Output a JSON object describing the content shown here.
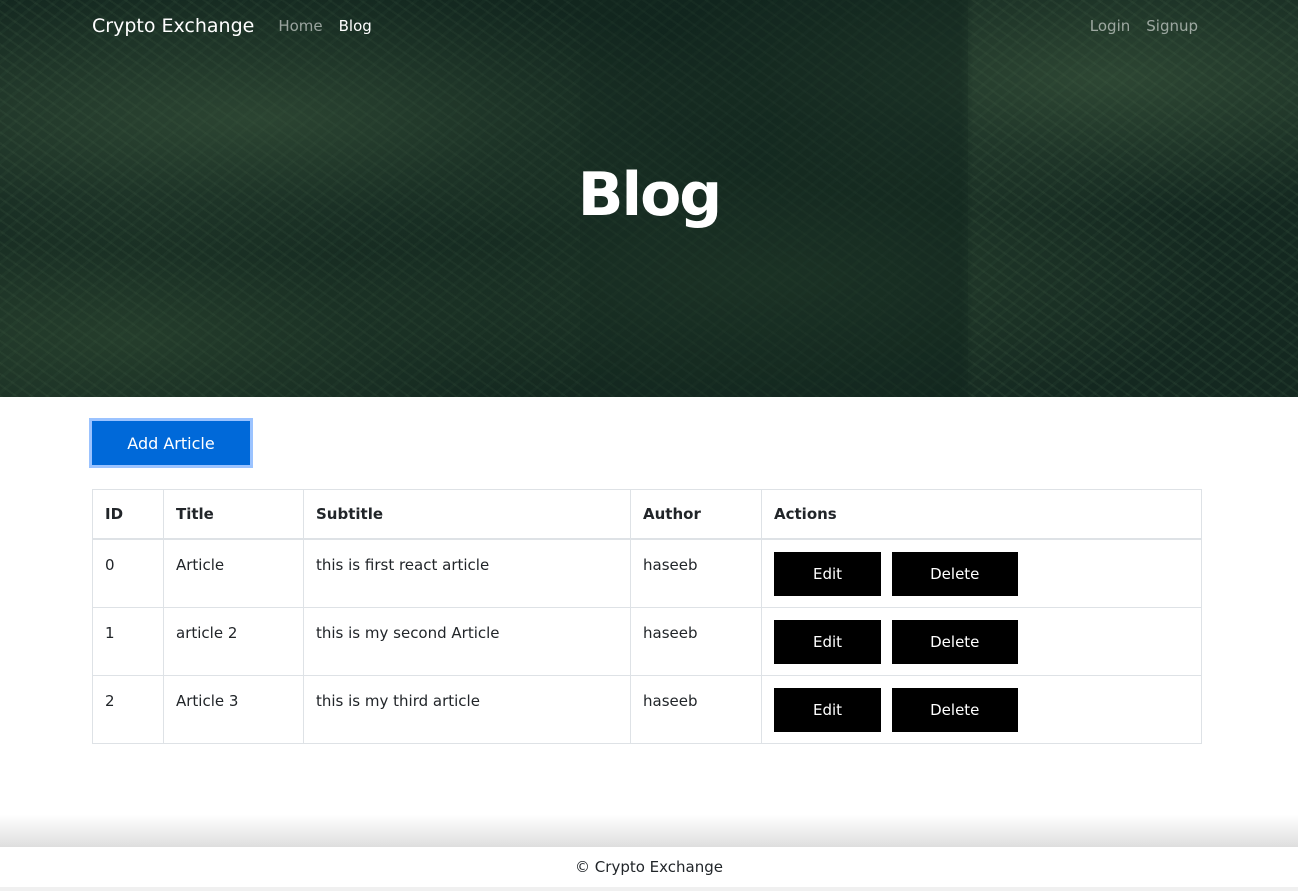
{
  "navbar": {
    "brand": "Crypto Exchange",
    "links": [
      "Home",
      "Blog"
    ],
    "right_links": [
      "Login",
      "Signup"
    ]
  },
  "hero": {
    "title": "Blog"
  },
  "main": {
    "add_button": "Add Article",
    "table": {
      "headers": [
        "ID",
        "Title",
        "Subtitle",
        "Author",
        "Actions"
      ],
      "rows": [
        {
          "id": "0",
          "title": "Article",
          "subtitle": "this is first react article",
          "author": "haseeb"
        },
        {
          "id": "1",
          "title": "article 2",
          "subtitle": "this is my second Article",
          "author": "haseeb"
        },
        {
          "id": "2",
          "title": "Article 3",
          "subtitle": "this is my third article",
          "author": "haseeb"
        }
      ],
      "edit_label": "Edit",
      "delete_label": "Delete"
    }
  },
  "footer": {
    "text": "© Crypto Exchange"
  },
  "colors": {
    "primary": "#0069d9",
    "action_button": "#000000"
  }
}
